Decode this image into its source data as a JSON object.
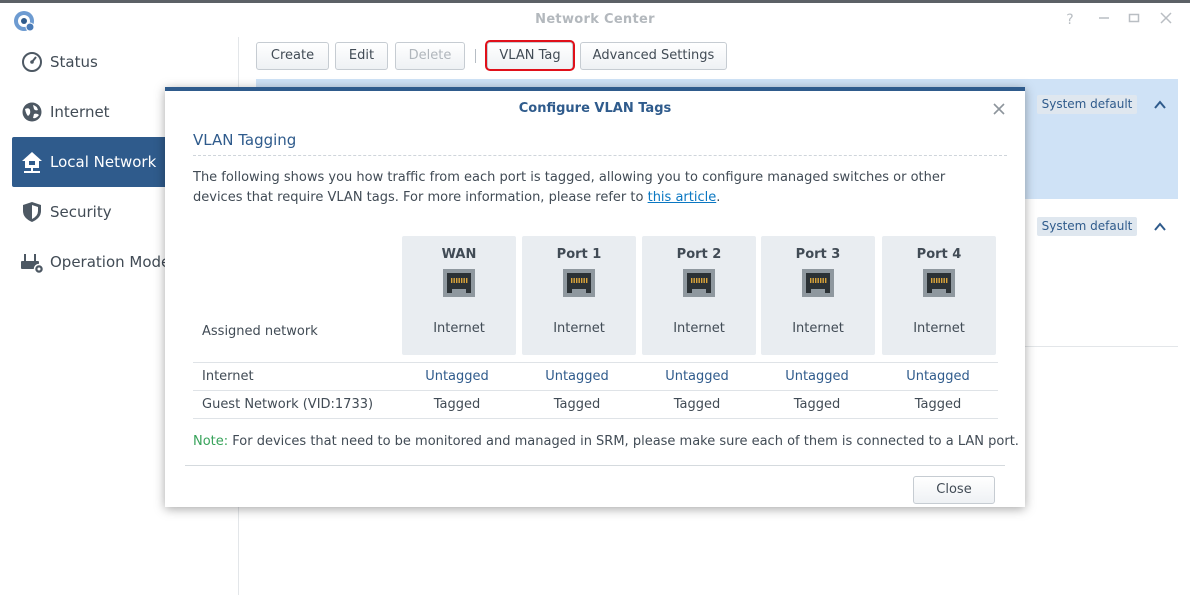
{
  "window": {
    "title": "Network Center",
    "controls": [
      "help-icon",
      "minimize-icon",
      "maximize-icon",
      "close-icon"
    ]
  },
  "sidebar": {
    "items": [
      {
        "label": "Status",
        "icon": "gauge-icon",
        "active": false
      },
      {
        "label": "Internet",
        "icon": "globe-icon",
        "active": false
      },
      {
        "label": "Local Network",
        "icon": "home-network-icon",
        "active": true
      },
      {
        "label": "Security",
        "icon": "shield-icon",
        "active": false
      },
      {
        "label": "Operation Modes",
        "icon": "router-gear-icon",
        "active": false
      }
    ]
  },
  "toolbar": {
    "create": "Create",
    "edit": "Edit",
    "delete": "Delete",
    "vlan_tag": "VLAN Tag",
    "advanced": "Advanced Settings"
  },
  "list": {
    "badges": [
      "System default",
      "System default"
    ]
  },
  "dialog": {
    "title": "Configure VLAN Tags",
    "section_title": "VLAN Tagging",
    "description": "The following shows you how traffic from each port is tagged, allowing you to configure managed switches or other devices that require VLAN tags. For more information, please refer to ",
    "link_text": "this article",
    "description_end": ".",
    "assigned_label": "Assigned network",
    "ports": [
      {
        "name": "WAN",
        "network": "Internet"
      },
      {
        "name": "Port 1",
        "network": "Internet"
      },
      {
        "name": "Port 2",
        "network": "Internet"
      },
      {
        "name": "Port 3",
        "network": "Internet"
      },
      {
        "name": "Port 4",
        "network": "Internet"
      }
    ],
    "rows": [
      {
        "network": "Internet",
        "values": [
          "Untagged",
          "Untagged",
          "Untagged",
          "Untagged",
          "Untagged"
        ]
      },
      {
        "network": "Guest Network (VID:1733)",
        "values": [
          "Tagged",
          "Tagged",
          "Tagged",
          "Tagged",
          "Tagged"
        ]
      }
    ],
    "note_tag": "Note:",
    "note_text": " For devices that need to be monitored and managed in SRM, please make sure each of them is connected to a LAN port.",
    "close_label": "Close"
  },
  "colors": {
    "accent": "#2f5b8c",
    "highlight": "#e0101a",
    "selection": "#cfe2f6",
    "note": "#38a35b"
  }
}
